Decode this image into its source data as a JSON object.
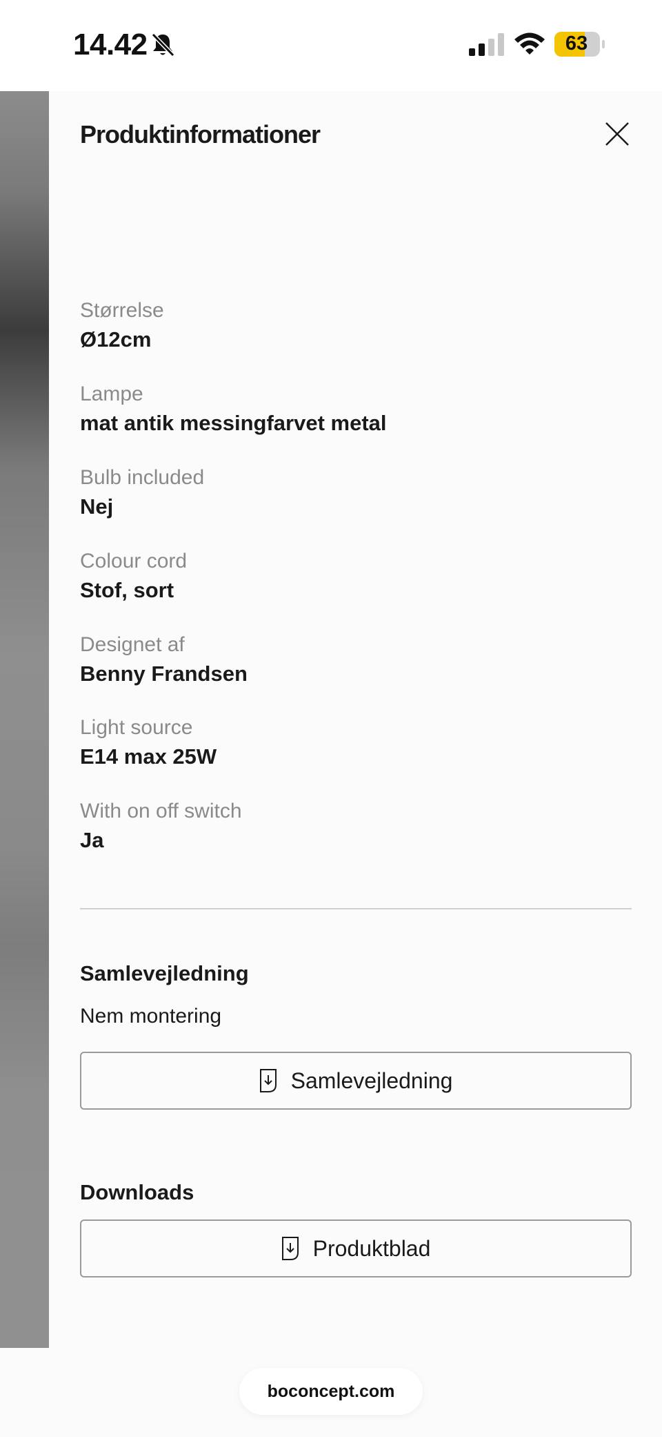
{
  "status_bar": {
    "time": "14.42",
    "battery": "63",
    "icons": [
      "bell-slash-icon",
      "signal-icon",
      "wifi-icon",
      "battery-icon"
    ],
    "battery_color": "#f5c400"
  },
  "drawer": {
    "title": "Produktinformationer",
    "close_icon": "close-icon",
    "specs": [
      {
        "label": "Størrelse",
        "value": "Ø12cm"
      },
      {
        "label": "Lampe",
        "value": "mat antik messingfarvet metal"
      },
      {
        "label": "Bulb included",
        "value": "Nej"
      },
      {
        "label": "Colour cord",
        "value": "Stof, sort"
      },
      {
        "label": "Designet af",
        "value": "Benny Frandsen"
      },
      {
        "label": "Light source",
        "value": "E14 max 25W"
      },
      {
        "label": "With on off switch",
        "value": "Ja"
      }
    ],
    "assembly": {
      "title": "Samlevejledning",
      "text": "Nem montering",
      "button_label": "Samlevejledning",
      "button_icon": "download-document-icon"
    },
    "downloads": {
      "title": "Downloads",
      "button_label": "Produktblad",
      "button_icon": "download-document-icon"
    }
  },
  "browser": {
    "url": "boconcept.com"
  }
}
